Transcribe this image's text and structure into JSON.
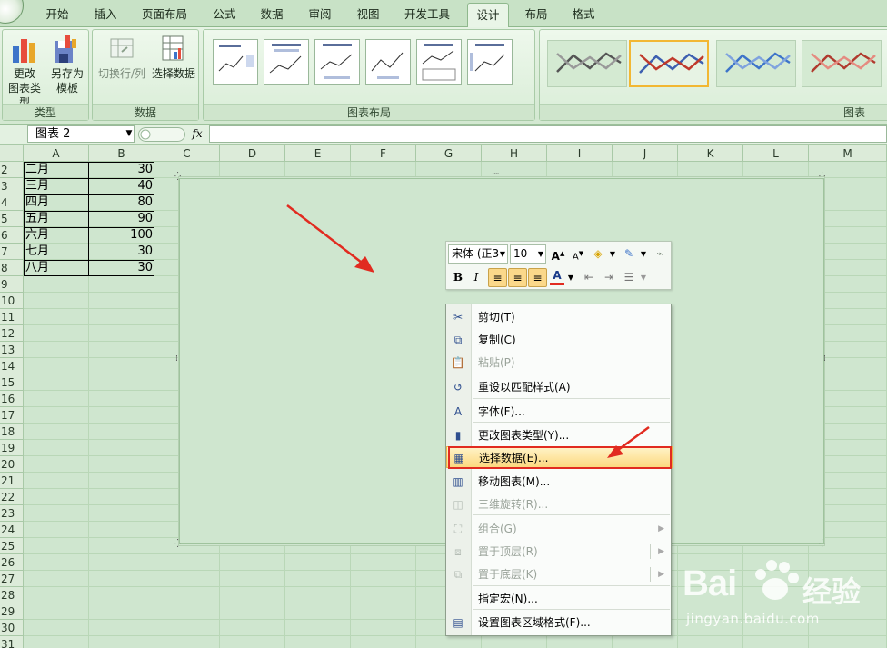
{
  "ribbon_tabs": [
    {
      "label": "开始",
      "active": false
    },
    {
      "label": "插入",
      "active": false
    },
    {
      "label": "页面布局",
      "active": false
    },
    {
      "label": "公式",
      "active": false
    },
    {
      "label": "数据",
      "active": false
    },
    {
      "label": "审阅",
      "active": false
    },
    {
      "label": "视图",
      "active": false
    },
    {
      "label": "开发工具",
      "active": false
    },
    {
      "label": "设计",
      "active": true
    },
    {
      "label": "布局",
      "active": false
    },
    {
      "label": "格式",
      "active": false
    }
  ],
  "ribbon": {
    "type_group": {
      "label": "类型",
      "change_type_line1": "更改",
      "change_type_line2": "图表类型",
      "save_template_line1": "另存为",
      "save_template_line2": "模板"
    },
    "data_group": {
      "label": "数据",
      "switch_row_col": "切换行/列",
      "select_data": "选择数据"
    },
    "layout_group": {
      "label": "图表布局"
    },
    "styles_group": {
      "label": "图表"
    }
  },
  "formula_bar": {
    "name_box": "图表 2",
    "fx": "fx",
    "value": ""
  },
  "columns": [
    "A",
    "B",
    "C",
    "D",
    "E",
    "F",
    "G",
    "H",
    "I",
    "J",
    "K",
    "L",
    "M"
  ],
  "rows": [
    "2",
    "3",
    "4",
    "5",
    "6",
    "7",
    "8",
    "9",
    "10",
    "11",
    "12",
    "13",
    "14",
    "15",
    "16",
    "17",
    "18",
    "19",
    "20",
    "21",
    "22",
    "23",
    "24",
    "25",
    "26",
    "27",
    "28",
    "29",
    "30",
    "31"
  ],
  "table": [
    {
      "month": "二月",
      "value": "30"
    },
    {
      "month": "三月",
      "value": "40"
    },
    {
      "month": "四月",
      "value": "80"
    },
    {
      "month": "五月",
      "value": "90"
    },
    {
      "month": "六月",
      "value": "100"
    },
    {
      "month": "七月",
      "value": "30"
    },
    {
      "month": "八月",
      "value": "30"
    }
  ],
  "mini_toolbar": {
    "font": "宋体 (正3",
    "size": "10",
    "bold": "B",
    "italic": "I",
    "font_color_letter": "A"
  },
  "context_menu": [
    {
      "label": "剪切(T)",
      "icon": "scissors-icon",
      "glyph": "✂",
      "disabled": false
    },
    {
      "label": "复制(C)",
      "icon": "copy-icon",
      "glyph": "⧉",
      "disabled": false
    },
    {
      "label": "粘贴(P)",
      "icon": "paste-icon",
      "glyph": "📋",
      "disabled": true
    },
    {
      "label": "重设以匹配样式(A)",
      "icon": "reset-style-icon",
      "glyph": "↺",
      "disabled": false
    },
    {
      "label": "字体(F)...",
      "icon": "font-icon",
      "glyph": "A",
      "disabled": false
    },
    {
      "label": "更改图表类型(Y)...",
      "icon": "chart-type-icon",
      "glyph": "▮",
      "disabled": false
    },
    {
      "label": "选择数据(E)...",
      "icon": "select-data-icon",
      "glyph": "▦",
      "disabled": false
    },
    {
      "label": "移动图表(M)...",
      "icon": "move-chart-icon",
      "glyph": "▥",
      "disabled": false
    },
    {
      "label": "三维旋转(R)...",
      "icon": "rotate-3d-icon",
      "glyph": "◫",
      "disabled": true
    },
    {
      "label": "组合(G)",
      "icon": "group-icon",
      "glyph": "⛶",
      "disabled": true
    },
    {
      "label": "置于顶层(R)",
      "icon": "bring-front-icon",
      "glyph": "⧈",
      "disabled": true
    },
    {
      "label": "置于底层(K)",
      "icon": "send-back-icon",
      "glyph": "⧉",
      "disabled": true
    },
    {
      "label": "指定宏(N)...",
      "icon": "",
      "glyph": "",
      "disabled": false
    },
    {
      "label": "设置图表区域格式(F)...",
      "icon": "format-chart-area-icon",
      "glyph": "▤",
      "disabled": false
    }
  ],
  "watermark": {
    "brand": "Bai",
    "brand2": "经验",
    "url": "jingyan.baidu.com"
  },
  "colors": {
    "accent_red": "#e12b20",
    "highlight": "#fcd97f",
    "sheet_bg": "#cfe6cf"
  }
}
